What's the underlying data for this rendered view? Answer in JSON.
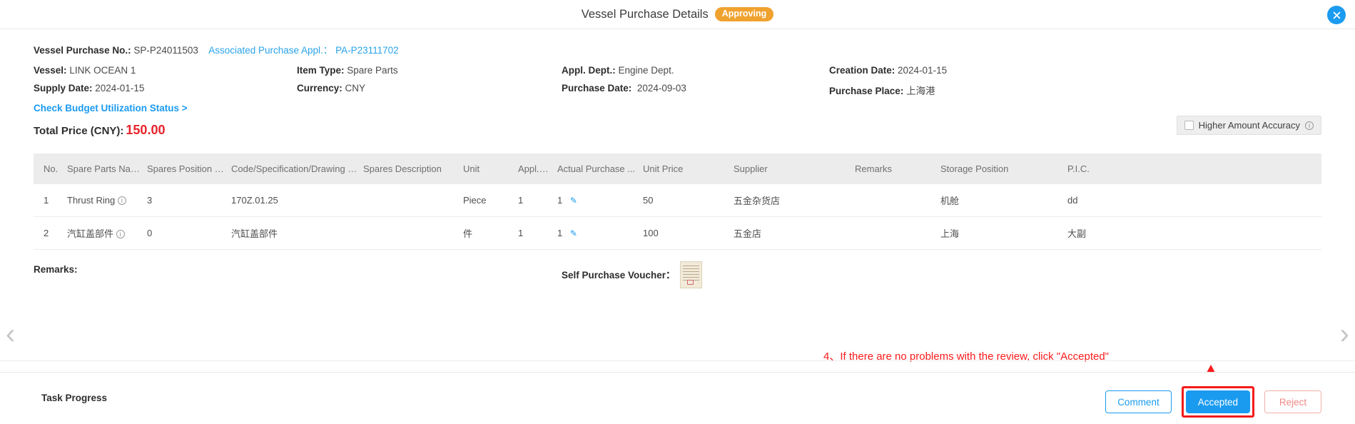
{
  "window": {
    "title": "Vessel Purchase Details",
    "status_badge": "Approving",
    "close_icon": "close-icon"
  },
  "header": {
    "purchase_no_label": "Vessel Purchase No.:",
    "purchase_no_value": "SP-P24011503",
    "associated_label": "Associated Purchase Appl.：",
    "associated_value": "PA-P23111702",
    "fields": [
      {
        "label": "Vessel:",
        "value": "LINK OCEAN 1"
      },
      {
        "label": "Item Type:",
        "value": "Spare Parts"
      },
      {
        "label": "Appl. Dept.:",
        "value": "Engine Dept."
      },
      {
        "label": "Creation Date:",
        "value": "2024-01-15"
      },
      {
        "label": "Supply Date:",
        "value": "2024-01-15"
      },
      {
        "label": "Currency:",
        "value": "CNY"
      },
      {
        "label": "Purchase Date:",
        "value": "2024-09-03"
      },
      {
        "label": "Purchase Place:",
        "value": "上海港"
      }
    ],
    "budget_link": "Check Budget Utilization Status >",
    "total_price_label": "Total Price (CNY):",
    "total_price_value": "150.00",
    "accuracy_label": "Higher Amount Accuracy",
    "accuracy_checked": false
  },
  "table": {
    "columns": [
      "No.",
      "Spare Parts Name",
      "Spares Position No.",
      "Code/Specification/Drawing No.",
      "Spares Description",
      "Unit",
      "Appl.Qty",
      "Actual Purchase ...",
      "Unit Price",
      "Supplier",
      "Remarks",
      "Storage Position",
      "P.I.C."
    ],
    "rows": [
      {
        "no": "1",
        "name": "Thrust Ring",
        "position_no": "3",
        "code": "170Z.01.25",
        "description": "",
        "unit": "Piece",
        "appl_qty": "1",
        "actual_purchase": "1",
        "unit_price": "50",
        "supplier": "五金杂货店",
        "remarks": "",
        "storage_position": "机舱",
        "pic": "dd"
      },
      {
        "no": "2",
        "name": "汽缸盖部件",
        "position_no": "0",
        "code": "汽缸盖部件",
        "description": "",
        "unit": "件",
        "appl_qty": "1",
        "actual_purchase": "1",
        "unit_price": "100",
        "supplier": "五金店",
        "remarks": "",
        "storage_position": "上海",
        "pic": "大副"
      }
    ]
  },
  "remarks_section": {
    "remarks_label": "Remarks:",
    "remarks_value": "",
    "voucher_label": "Self Purchase Voucher："
  },
  "annotation": {
    "text": "4、If there are no problems with the review, click \"Accepted\"",
    "color": "#fb1b1b"
  },
  "footer": {
    "task_progress_label": "Task Progress",
    "buttons": {
      "comment": "Comment",
      "accepted": "Accepted",
      "reject": "Reject"
    }
  },
  "nav": {
    "prev_icon": "chevron-left-icon",
    "next_icon": "chevron-right-icon"
  }
}
